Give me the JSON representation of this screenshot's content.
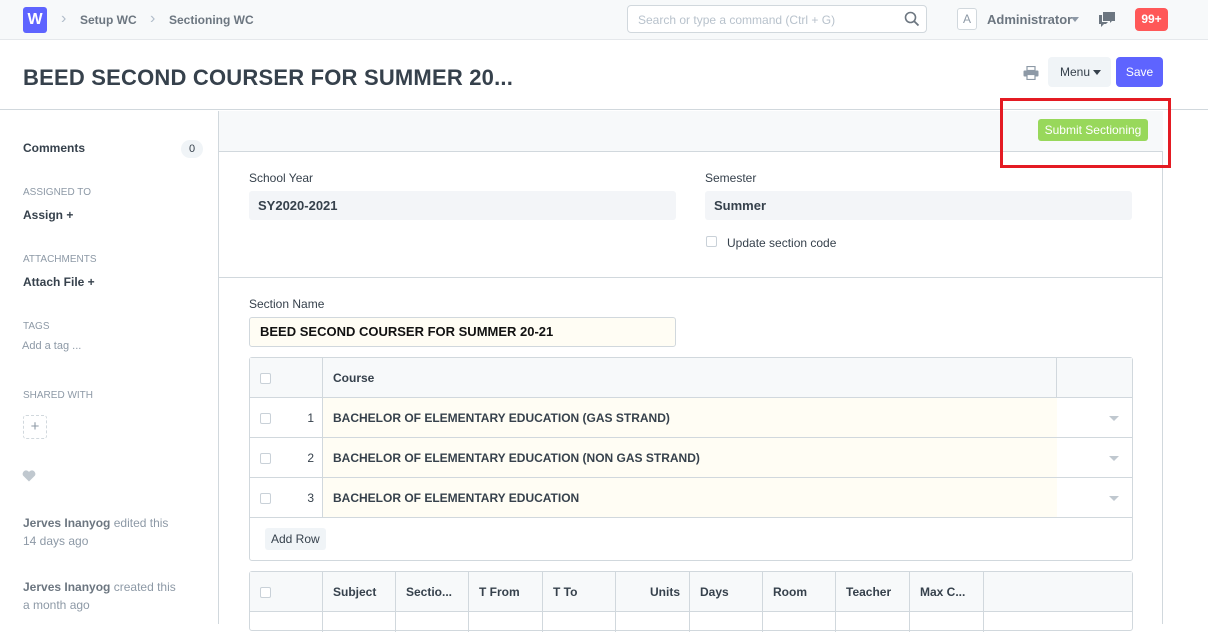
{
  "navbar": {
    "logo": "W",
    "breadcrumbs": [
      "Setup WC",
      "Sectioning WC"
    ],
    "search_placeholder": "Search or type a command (Ctrl + G)",
    "avatar_letter": "A",
    "user": "Administrator",
    "notifications": "99+"
  },
  "page": {
    "title": "BEED SECOND COURSER FOR SUMMER 20...",
    "menu_label": "Menu",
    "save_label": "Save"
  },
  "sidebar": {
    "comments_label": "Comments",
    "comments_count": "0",
    "assigned_to_label": "ASSIGNED TO",
    "assign_label": "Assign +",
    "attachments_label": "ATTACHMENTS",
    "attach_label": "Attach File +",
    "tags_label": "TAGS",
    "add_tag_label": "Add a tag ...",
    "shared_with_label": "SHARED WITH",
    "shared_plus": "+",
    "activity": [
      {
        "user": "Jerves Inanyog",
        "action": "edited this",
        "time": "14 days ago"
      },
      {
        "user": "Jerves Inanyog",
        "action": "created this",
        "time": "a month ago"
      }
    ]
  },
  "form": {
    "submit_label": "Submit Sectioning",
    "school_year_label": "School Year",
    "school_year_value": "SY2020-2021",
    "semester_label": "Semester",
    "semester_value": "Summer",
    "update_code_label": "Update section code",
    "section_name_label": "Section Name",
    "section_name_value": "BEED SECOND COURSER FOR SUMMER 20-21",
    "course_grid": {
      "header": "Course",
      "rows": [
        {
          "num": "1",
          "course": "BACHELOR OF ELEMENTARY EDUCATION (GAS STRAND)"
        },
        {
          "num": "2",
          "course": "BACHELOR OF ELEMENTARY EDUCATION (NON GAS STRAND)"
        },
        {
          "num": "3",
          "course": "BACHELOR OF ELEMENTARY EDUCATION"
        }
      ],
      "add_row_label": "Add Row"
    },
    "subject_grid": {
      "headers": [
        "Subject",
        "Sectio...",
        "T From",
        "T To",
        "Units",
        "Days",
        "Room",
        "Teacher",
        "Max C..."
      ]
    }
  },
  "colors": {
    "brand": "#5e64ff",
    "submit": "#98d85b",
    "notification": "#ff5858",
    "highlight_box": "#e41b23"
  }
}
